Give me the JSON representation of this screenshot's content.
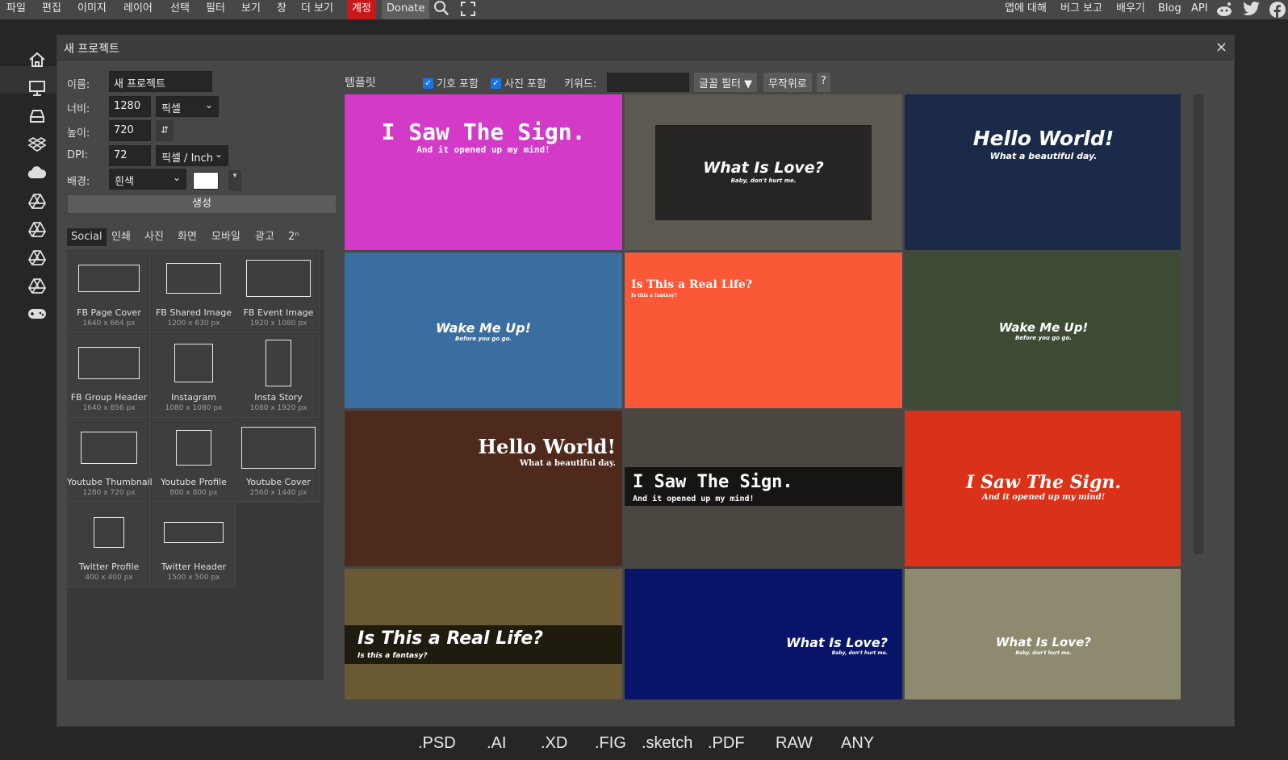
{
  "menu": {
    "file": "파일",
    "edit": "편집",
    "image": "이미지",
    "layer": "레이어",
    "select": "선택",
    "filter": "필터",
    "view": "보기",
    "window": "창",
    "more": "더 보기",
    "account": "계정",
    "donate": "Donate",
    "about": "앱에 대해",
    "bug": "버그 보고",
    "learn": "배우기",
    "blog": "Blog",
    "api": "API"
  },
  "dialog": {
    "title": "새 프로젝트",
    "close": "×"
  },
  "form": {
    "name_label": "이름:",
    "name_value": "새 프로젝트",
    "width_label": "너비:",
    "width_value": "1280",
    "unit": "픽셀",
    "height_label": "높이:",
    "height_value": "720",
    "swap": "⇵",
    "dpi_label": "DPI:",
    "dpi_value": "72",
    "dpi_unit": "픽셀 / Inch",
    "bg_label": "배경:",
    "bg_value": "흰색",
    "bg_color": "#ffffff",
    "create": "생성"
  },
  "tabs": [
    "Social",
    "인쇄",
    "사진",
    "화면",
    "모바일",
    "광고",
    "2ⁿ"
  ],
  "presets": [
    {
      "name": "FB Page Cover",
      "size": "1640 x 664 px"
    },
    {
      "name": "FB Shared Image",
      "size": "1200 x 630 px"
    },
    {
      "name": "FB Event Image",
      "size": "1920 x 1080 px"
    },
    {
      "name": "FB Group Header",
      "size": "1640 x 856 px"
    },
    {
      "name": "Instagram",
      "size": "1080 x 1080 px"
    },
    {
      "name": "Insta Story",
      "size": "1080 x 1920 px"
    },
    {
      "name": "Youtube Thumbnail",
      "size": "1280 x 720 px"
    },
    {
      "name": "Youtube Profile",
      "size": "800 x 800 px"
    },
    {
      "name": "Youtube Cover",
      "size": "2560 x 1440 px"
    },
    {
      "name": "Twitter Profile",
      "size": "400 x 400 px"
    },
    {
      "name": "Twitter Header",
      "size": "1500 x 500 px"
    }
  ],
  "templates_header": {
    "title": "템플릿",
    "symbols": "기호 포함",
    "photos": "사진 포함",
    "keyword_label": "키워드:",
    "font_filter": "글꼴 필터",
    "random": "무작위로",
    "help": "?"
  },
  "templates": [
    {
      "title": "I Saw The Sign.",
      "sub": "And it opened up my mind!",
      "bg": "#d33ac8"
    },
    {
      "title": "What Is Love?",
      "sub": "Baby, don't hurt me.",
      "bg": "#5d5850"
    },
    {
      "title": "Hello World!",
      "sub": "What a beautiful day.",
      "bg": "#1b2a48"
    },
    {
      "title": "Wake Me Up!",
      "sub": "Before you go go.",
      "bg": "#3b6ea0"
    },
    {
      "title": "Is This a Real Life?",
      "sub": "Is this a fantasy?",
      "bg": "#fb5837"
    },
    {
      "title": "Wake Me Up!",
      "sub": "Before you go go.",
      "bg": "#3d4a34"
    },
    {
      "title": "Hello World!",
      "sub": "What a beautiful day.",
      "bg": "#4e2a1c"
    },
    {
      "title": "I Saw The Sign.",
      "sub": "And it opened up my mind!",
      "bg": "#4b4740"
    },
    {
      "title": "I Saw The Sign.",
      "sub": "And it opened up my mind!",
      "bg": "#da3218"
    },
    {
      "title": "Is This a Real Life?",
      "sub": "Is this a fantasy?",
      "bg": "#6a5a33"
    },
    {
      "title": "What Is Love?",
      "sub": "Baby, don't hurt me.",
      "bg": "#08136a"
    },
    {
      "title": "What Is Love?",
      "sub": "Baby, don't hurt me.",
      "bg": "#8e8a70"
    }
  ],
  "formats": [
    ".PSD",
    ".AI",
    ".XD",
    ".FIG",
    ".sketch",
    ".PDF",
    "RAW",
    "ANY"
  ],
  "format_colors": [
    "#31a8ff",
    "#ff9a00",
    "#ff61f6",
    "#0acf83",
    "#fdad00",
    "#e5252a",
    "#888888",
    "#000000"
  ]
}
